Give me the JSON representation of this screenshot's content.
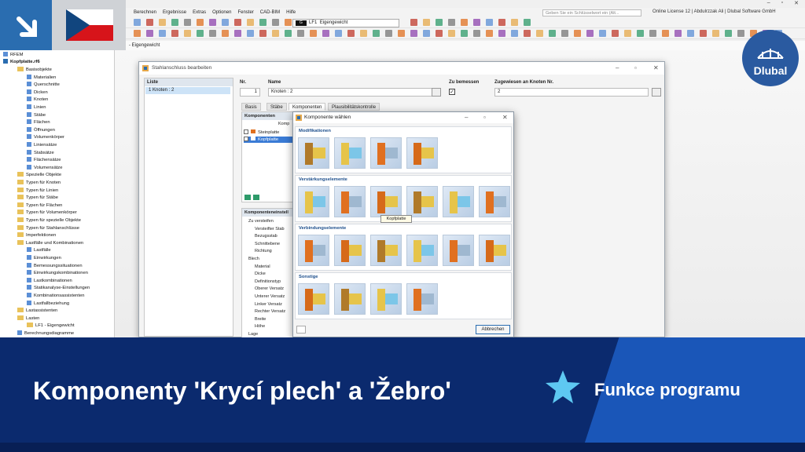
{
  "menu": {
    "items": [
      "Berechnen",
      "Ergebnisse",
      "Extras",
      "Optionen",
      "Fenster",
      "CAD-BIM",
      "Hilfe"
    ],
    "search_placeholder": "Geben Sie ein Schlüsselwort ein (Alt...",
    "license": "Online License 12 | Abdulrzzak Ali | Dlubal Software GmbH"
  },
  "toolbar": {
    "lc_badge": "G",
    "lc_id": "LF1",
    "lc_name": "Eigengewicht",
    "load_strip": "- Eigengewicht"
  },
  "navigator": {
    "root": "RFEM",
    "file": "Kopfplatte.rf6",
    "items": [
      {
        "label": "Basisobjekte",
        "kind": "folder",
        "indent": 1
      },
      {
        "label": "Materialien",
        "kind": "item",
        "indent": 2
      },
      {
        "label": "Querschnitte",
        "kind": "item",
        "indent": 2
      },
      {
        "label": "Dicken",
        "kind": "item",
        "indent": 2
      },
      {
        "label": "Knoten",
        "kind": "item",
        "indent": 2
      },
      {
        "label": "Linien",
        "kind": "item",
        "indent": 2
      },
      {
        "label": "Stäbe",
        "kind": "item",
        "indent": 2
      },
      {
        "label": "Flächen",
        "kind": "item",
        "indent": 2
      },
      {
        "label": "Öffnungen",
        "kind": "item",
        "indent": 2
      },
      {
        "label": "Volumenkörper",
        "kind": "item",
        "indent": 2
      },
      {
        "label": "Liniensätze",
        "kind": "item",
        "indent": 2
      },
      {
        "label": "Stabsätze",
        "kind": "item",
        "indent": 2
      },
      {
        "label": "Flächensätze",
        "kind": "item",
        "indent": 2
      },
      {
        "label": "Volumensätze",
        "kind": "item",
        "indent": 2
      },
      {
        "label": "Spezielle Objekte",
        "kind": "folder",
        "indent": 1
      },
      {
        "label": "Typen für Knoten",
        "kind": "folder",
        "indent": 1
      },
      {
        "label": "Typen für Linien",
        "kind": "folder",
        "indent": 1
      },
      {
        "label": "Typen für Stäbe",
        "kind": "folder",
        "indent": 1
      },
      {
        "label": "Typen für Flächen",
        "kind": "folder",
        "indent": 1
      },
      {
        "label": "Typen für Volumenkörper",
        "kind": "folder",
        "indent": 1
      },
      {
        "label": "Typen für spezielle Objekte",
        "kind": "folder",
        "indent": 1
      },
      {
        "label": "Typen für Stahlanschlüsse",
        "kind": "folder",
        "indent": 1
      },
      {
        "label": "Imperfektionen",
        "kind": "folder",
        "indent": 1
      },
      {
        "label": "Lastfälle und Kombinationen",
        "kind": "folder",
        "indent": 1
      },
      {
        "label": "Lastfälle",
        "kind": "item",
        "indent": 2
      },
      {
        "label": "Einwirkungen",
        "kind": "item",
        "indent": 2
      },
      {
        "label": "Bemessungssituationen",
        "kind": "item",
        "indent": 2
      },
      {
        "label": "Einwirkungskombinationen",
        "kind": "item",
        "indent": 2
      },
      {
        "label": "Lastkombinationen",
        "kind": "item",
        "indent": 2
      },
      {
        "label": "Statikanalyse-Einstellungen",
        "kind": "item",
        "indent": 2
      },
      {
        "label": "Kombinationsassistenten",
        "kind": "item",
        "indent": 2
      },
      {
        "label": "Lastfallbeziehung",
        "kind": "item",
        "indent": 2
      },
      {
        "label": "Lastassistenten",
        "kind": "folder",
        "indent": 1
      },
      {
        "label": "Lasten",
        "kind": "folder",
        "indent": 1
      },
      {
        "label": "LF1 - Eigengewicht",
        "kind": "folder",
        "indent": 2
      },
      {
        "label": "Berechnungsdiagramme",
        "kind": "item",
        "indent": 1
      }
    ]
  },
  "dialog1": {
    "title": "Stahlanschluss bearbeiten",
    "liste_header": "Liste",
    "liste_item": "1  Knoten : 2",
    "nr_label": "Nr.",
    "nr_value": "1",
    "name_label": "Name",
    "name_value": "Knoten : 2",
    "zu_bemessen_label": "Zu bemessen",
    "zugewiesen_label": "Zugewiesen an Knoten Nr.",
    "zugewiesen_value": "2",
    "tabs": [
      "Basis",
      "Stäbe",
      "Komponenten",
      "Plausibilitätskontrolle"
    ],
    "komp_header": "Komponenten",
    "komp_col": "Komp",
    "komp_items": [
      {
        "label": "Steinplatte",
        "color": "#e07020"
      },
      {
        "label": "Kopfplatte",
        "color": "#3a7bd5"
      }
    ],
    "einst_header": "Komponenteneinstell",
    "einst_items": [
      "Zu versteifen",
      "Versteifter Stab",
      "Bezugsstab",
      "Schnittebene",
      "Richtung",
      "Blech",
      "Material",
      "Dicke",
      "Definitionstyp",
      "Oberer Versatz",
      "Unterer Versatz",
      "Linker Versatz",
      "Rechter Versatz",
      "Breite",
      "Höhe",
      "Lage"
    ]
  },
  "dialog2": {
    "title": "Komponente wählen",
    "sections": [
      "Modifikationen",
      "Verstärkungselemente",
      "Verbindungselemente",
      "Sonstige"
    ],
    "tooltip": "Kopfplatte",
    "cancel": "Abbrechen"
  },
  "branding": {
    "logo_text": "Dlubal"
  },
  "banner": {
    "title": "Komponenty 'Krycí plech' a 'Žebro'",
    "subtitle": "Funkce programu"
  },
  "colors": {
    "banner_dark": "#0b2a6e",
    "banner_accent": "#1a56b8",
    "accent_blue": "#2a6db0",
    "steel_blue": "#7cc6e8"
  }
}
